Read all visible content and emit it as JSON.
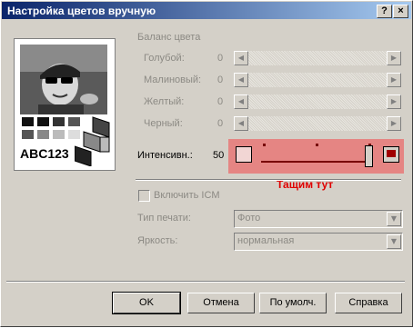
{
  "window": {
    "title": "Настройка цветов вручную"
  },
  "titlebar_buttons": {
    "help": "?",
    "close": "×"
  },
  "preview": {
    "sample_text": "ABC123"
  },
  "color_balance": {
    "group_label": "Баланс цвета",
    "rows": [
      {
        "label": "Голубой:",
        "value": "0"
      },
      {
        "label": "Малиновый:",
        "value": "0"
      },
      {
        "label": "Желтый:",
        "value": "0"
      },
      {
        "label": "Черный:",
        "value": "0"
      }
    ]
  },
  "intensity": {
    "label": "Интенсивн.:",
    "value": "50",
    "level_fraction": 1.0
  },
  "annotation": {
    "text": "Тащим тут",
    "color": "#e00000",
    "highlight": "#e58583"
  },
  "icm": {
    "label": "Включить ICM",
    "checked": false
  },
  "print_type": {
    "label": "Тип печати:",
    "value": "Фото"
  },
  "brightness": {
    "label": "Яркость:",
    "value": "нормальная"
  },
  "buttons": {
    "ok": "OK",
    "cancel": "Отмена",
    "default": "По умолч.",
    "help": "Справка"
  },
  "colors": {
    "titlebar_start": "#0a246a",
    "titlebar_end": "#a6caf0",
    "dialog_bg": "#d4d0c8",
    "disabled_text": "#8c8a84"
  }
}
